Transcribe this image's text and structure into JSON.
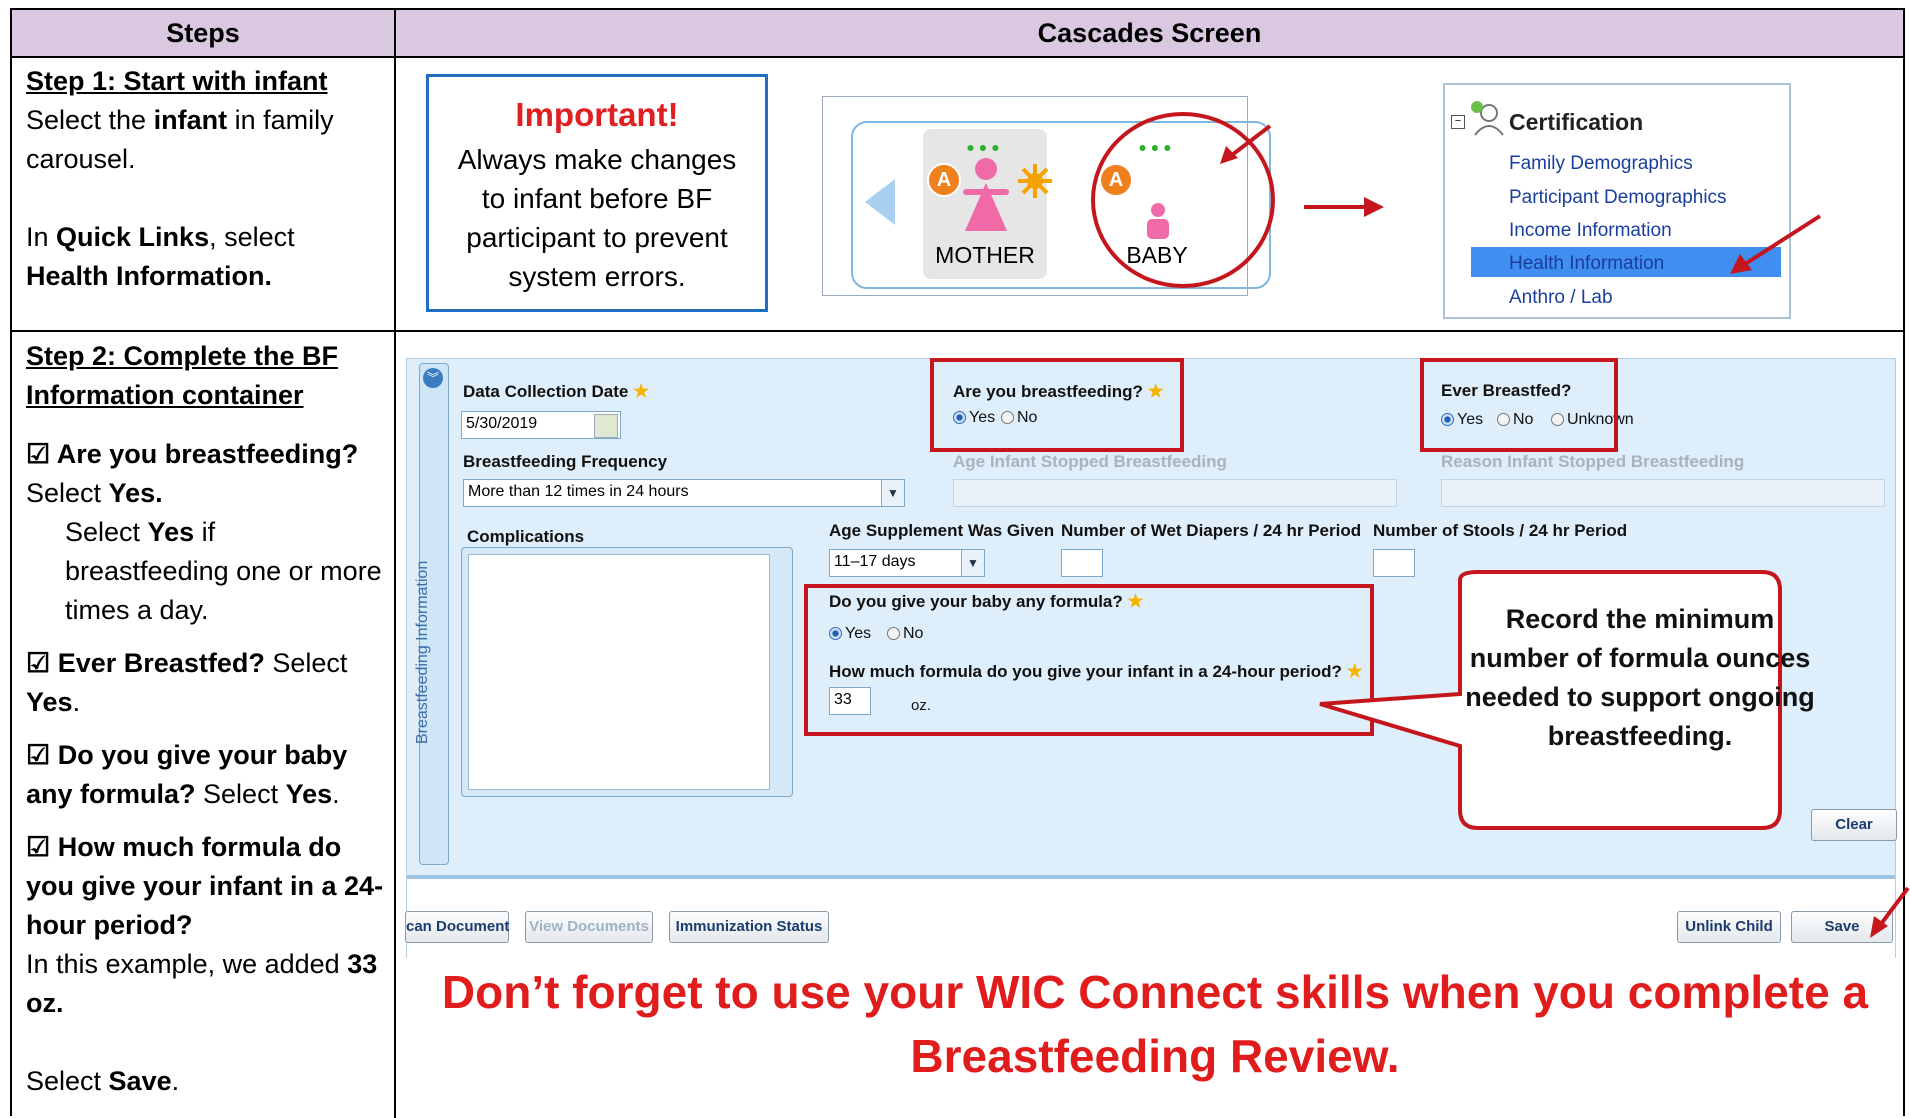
{
  "header": {
    "steps": "Steps",
    "screen": "Cascades Screen"
  },
  "step1": {
    "title": "Step 1: Start with infant",
    "line1_pre": "Select the ",
    "line1_bold": "infant",
    "line1_post": " in family carousel.",
    "line2_pre": "In ",
    "line2_bold": "Quick Links",
    "line2_post": ", select",
    "line3_bold": "Health Information."
  },
  "important": {
    "title": "Important!",
    "body": "Always make changes to infant before BF participant to prevent system errors."
  },
  "carousel": {
    "mother_label": "MOTHER",
    "baby_label": "BABY",
    "badge": "A",
    "dots": "●●●"
  },
  "certification": {
    "title": "Certification",
    "items": [
      "Family Demographics",
      "Participant Demographics",
      "Income Information",
      "Health Information",
      "Anthro / Lab"
    ]
  },
  "step2": {
    "title": "Step 2: Complete the BF Information container",
    "checkbox": "☑",
    "q1_bold": "Are you breastfeeding?",
    "q1_a_pre": "Select ",
    "q1_a_bold": "Yes.",
    "q1_note_pre": "Select ",
    "q1_note_bold": "Yes",
    "q1_note_post": " if breastfeeding one or more times a day.",
    "q2_bold": "Ever Breastfed?",
    "q2_pre": " Select ",
    "q2_a_bold": "Yes",
    "q2_post": ".",
    "q3_bold": "Do you give your baby any formula?",
    "q3_pre": " Select ",
    "q3_a_bold": "Yes",
    "q3_post": ".",
    "q4_bold": "How much formula do you give your infant in a 24-hour period?",
    "q4_note_pre": "In this example, we added ",
    "q4_note_bold": "33 oz.",
    "save_pre": "Select ",
    "save_bold": "Save",
    "save_post": "."
  },
  "form": {
    "side_label": "Breastfeeding Information",
    "data_collection_date_label": "Data Collection Date",
    "data_collection_date_value": "5/30/2019",
    "bf_frequency_label": "Breastfeeding Frequency",
    "bf_frequency_value": "More than 12 times in 24 hours",
    "are_you_bf_label": "Are you breastfeeding?",
    "yes": "Yes",
    "no": "No",
    "unknown": "Unknown",
    "age_stopped_label": "Age Infant Stopped Breastfeeding",
    "ever_bf_label": "Ever Breastfed?",
    "reason_stopped_label": "Reason Infant Stopped Breastfeeding",
    "complications_label": "Complications",
    "age_supplement_label": "Age Supplement Was Given",
    "age_supplement_value": "11–17 days",
    "wet_diapers_label": "Number of Wet Diapers / 24 hr Period",
    "stools_label": "Number of Stools / 24 hr Period",
    "formula_q_label": "Do you give your baby any formula?",
    "formula_amount_label": "How much formula do you give your infant in a 24-hour period?",
    "formula_amount_value": "33",
    "formula_unit": "oz.",
    "clear_button": "Clear"
  },
  "buttons": {
    "scan_document": "can Document",
    "view_documents": "View Documents",
    "immunization_status": "Immunization Status",
    "unlink_child": "Unlink Child",
    "save": "Save"
  },
  "callout": {
    "text": "Record the minimum number of formula ounces needed to support ongoing breastfeeding."
  },
  "footer": {
    "text": "Don’t forget to use your WIC Connect skills when you complete a Breastfeeding Review."
  },
  "colors": {
    "accent_red": "#c4161c",
    "header_bg": "#d9c8e0",
    "important_border": "#1f6fc5",
    "selected_blue": "#3f8ef0"
  }
}
